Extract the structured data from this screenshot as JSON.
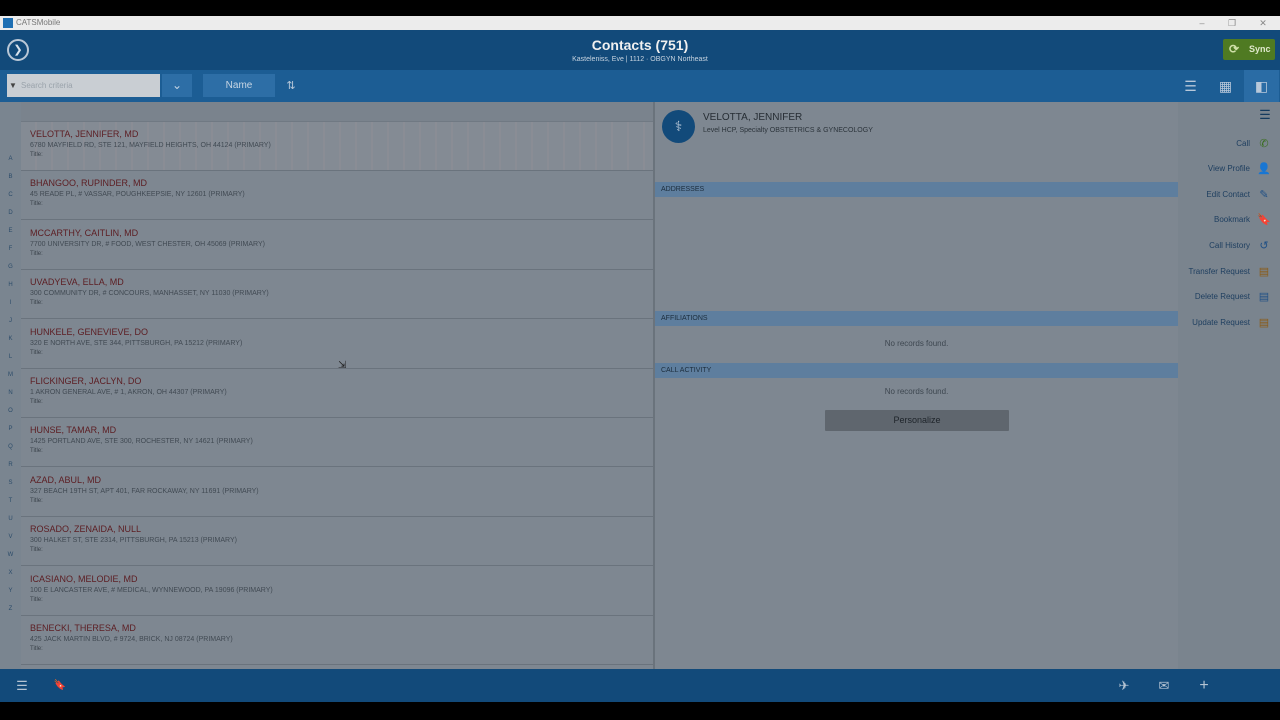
{
  "window": {
    "app_name": "CATSMobile",
    "minimize": "–",
    "restore": "❐",
    "close": "✕"
  },
  "header": {
    "logo_icon": "❯",
    "title": "Contacts (751)",
    "subtitle": "Kasteleniss, Eve | 1112 · OBGYN Northeast",
    "sync_icon": "⟳",
    "sync_label": "Sync"
  },
  "toolbar": {
    "search_placeholder": "Search criteria",
    "filter_icon": "▼",
    "dropdown_icon": "⌄",
    "sort_field": "Name",
    "sort_icon": "⇅",
    "view_list_icon": "☰",
    "view_grid_icon": "▦",
    "view_split_icon": "◧"
  },
  "letters": [
    "A",
    "B",
    "C",
    "D",
    "E",
    "F",
    "G",
    "H",
    "I",
    "J",
    "K",
    "L",
    "M",
    "N",
    "O",
    "P",
    "Q",
    "R",
    "S",
    "T",
    "U",
    "V",
    "W",
    "X",
    "Y",
    "Z"
  ],
  "contacts": [
    {
      "name": "VELOTTA, JENNIFER, MD",
      "address": "6780 MAYFIELD RD, STE 121, MAYFIELD HEIGHTS, OH 44124 (PRIMARY)",
      "title": "Title:"
    },
    {
      "name": "BHANGOO, RUPINDER, MD",
      "address": "45 READE PL, # VASSAR, POUGHKEEPSIE, NY 12601 (PRIMARY)",
      "title": "Title:"
    },
    {
      "name": "MCCARTHY, CAITLIN, MD",
      "address": "7700 UNIVERSITY DR, # FOOD, WEST CHESTER, OH 45069 (PRIMARY)",
      "title": "Title:"
    },
    {
      "name": "UVADYEVA, ELLA, MD",
      "address": "300 COMMUNITY DR, # CONCOURS, MANHASSET, NY 11030 (PRIMARY)",
      "title": "Title:"
    },
    {
      "name": "HUNKELE, GENEVIEVE, DO",
      "address": "320 E NORTH AVE, STE 344, PITTSBURGH, PA 15212 (PRIMARY)",
      "title": "Title:"
    },
    {
      "name": "FLICKINGER, JACLYN, DO",
      "address": "1 AKRON GENERAL AVE, # 1, AKRON, OH 44307 (PRIMARY)",
      "title": "Title:"
    },
    {
      "name": "HUNSE, TAMAR, MD",
      "address": "1425 PORTLAND AVE, STE 300, ROCHESTER, NY 14621 (PRIMARY)",
      "title": "Title:"
    },
    {
      "name": "AZAD, ABUL, MD",
      "address": "327 BEACH 19TH ST, APT 401, FAR ROCKAWAY, NY 11691 (PRIMARY)",
      "title": "Title:"
    },
    {
      "name": "ROSADO, ZENAIDA, NULL",
      "address": "300 HALKET ST, STE 2314, PITTSBURGH, PA 15213 (PRIMARY)",
      "title": "Title:"
    },
    {
      "name": "ICASIANO, MELODIE, MD",
      "address": "100 E LANCASTER AVE, # MEDICAL, WYNNEWOOD, PA 19096 (PRIMARY)",
      "title": "Title:"
    },
    {
      "name": "BENECKI, THERESA, MD",
      "address": "425 JACK MARTIN BLVD, # 9724, BRICK, NJ 08724 (PRIMARY)",
      "title": "Title:"
    }
  ],
  "detail": {
    "avatar_icon": "⚕",
    "name": "VELOTTA, JENNIFER",
    "level": "Level HCP, Specialty OBSTETRICS & GYNECOLOGY",
    "addresses_label": "ADDRESSES",
    "affiliations_label": "AFFILIATIONS",
    "affiliations_empty": "No records found.",
    "call_activity_label": "CALL ACTIVITY",
    "call_activity_empty": "No records found.",
    "personalize_label": "Personalize"
  },
  "actions": {
    "menu_icon": "☰",
    "items": [
      {
        "label": "Call",
        "icon": "✆",
        "color": "#3a6e1f"
      },
      {
        "label": "View Profile",
        "icon": "👤",
        "color": "#1f4f85"
      },
      {
        "label": "Edit Contact",
        "icon": "✎",
        "color": "#1f4f85"
      },
      {
        "label": "Bookmark",
        "icon": "🔖",
        "color": "#1f4f85"
      },
      {
        "label": "Call History",
        "icon": "↺",
        "color": "#1f4f85"
      },
      {
        "label": "Transfer Request",
        "icon": "▤",
        "color": "#8a5a14"
      },
      {
        "label": "Delete Request",
        "icon": "▤",
        "color": "#1f4f85"
      },
      {
        "label": "Update Request",
        "icon": "▤",
        "color": "#8a5a14"
      }
    ]
  },
  "footer": {
    "list_icon": "☰",
    "bookmark_icon": "🔖",
    "route_icon": "✈",
    "mail_icon": "✉",
    "add_icon": "+"
  },
  "cursor_icon": "⇲"
}
